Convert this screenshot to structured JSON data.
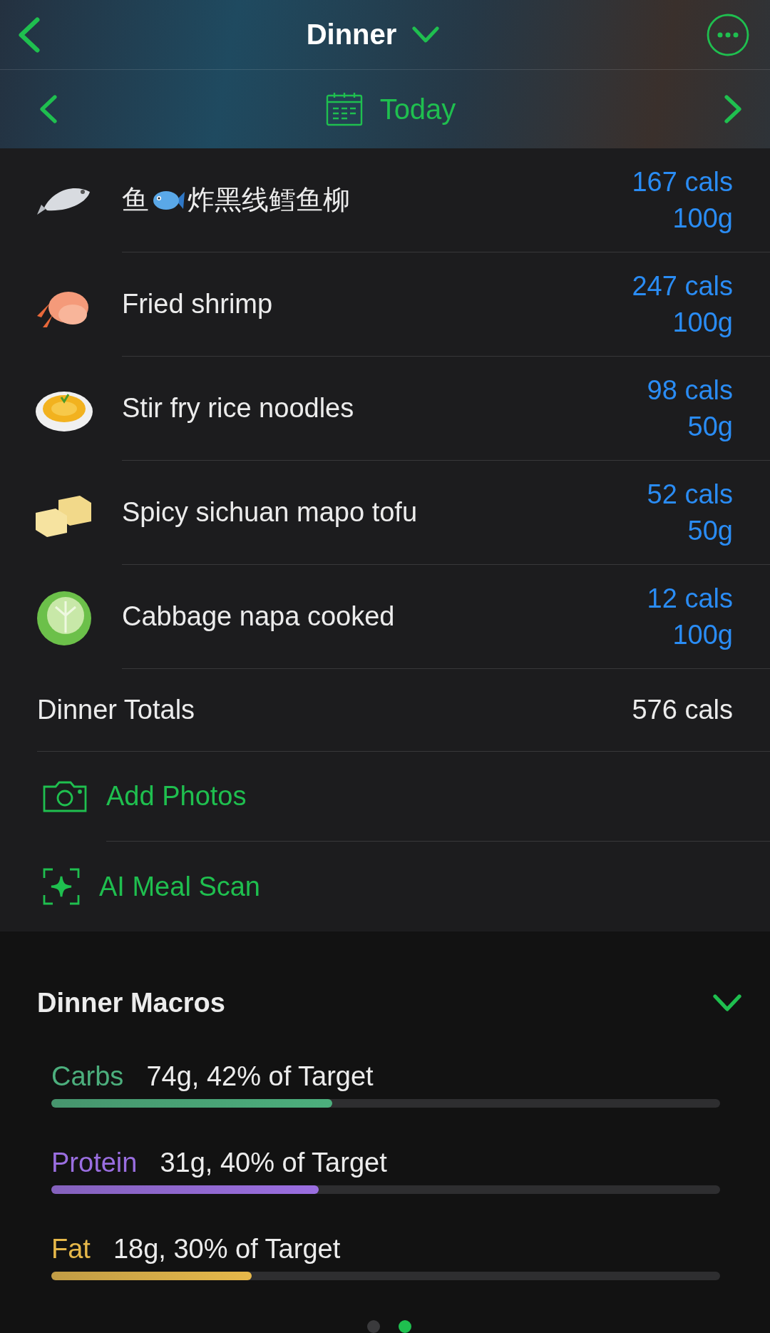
{
  "header": {
    "title": "Dinner",
    "date_label": "Today"
  },
  "foods": [
    {
      "kind": "fish",
      "name": "鱼",
      "name_after_icon": "炸黑线鳕鱼柳",
      "cals": "167 cals",
      "amount": "100g"
    },
    {
      "kind": "shrimp",
      "name": "Fried shrimp",
      "cals": "247 cals",
      "amount": "100g"
    },
    {
      "kind": "noodles",
      "name": "Stir fry rice noodles",
      "cals": "98 cals",
      "amount": "50g"
    },
    {
      "kind": "tofu",
      "name": "Spicy sichuan mapo tofu",
      "cals": "52 cals",
      "amount": "50g"
    },
    {
      "kind": "cabbage",
      "name": "Cabbage napa cooked",
      "cals": "12 cals",
      "amount": "100g"
    }
  ],
  "totals": {
    "label": "Dinner Totals",
    "value": "576 cals"
  },
  "actions": [
    {
      "kind": "camera",
      "label": "Add Photos"
    },
    {
      "kind": "scan",
      "label": "AI Meal Scan"
    }
  ],
  "macros": {
    "title": "Dinner Macros",
    "expanded": true,
    "items": [
      {
        "name": "Carbs",
        "reading": "74g, 42% of Target",
        "level": 0.42,
        "color": "#4caf7d"
      },
      {
        "name": "Protein",
        "reading": "31g, 40% of Target",
        "level": 0.4,
        "color": "#9a6ee0"
      },
      {
        "name": "Fat",
        "reading": "18g, 30% of Target",
        "level": 0.3,
        "color": "#e6b84a"
      }
    ]
  },
  "pages": [
    {
      "selected": false
    },
    {
      "selected": true
    }
  ]
}
